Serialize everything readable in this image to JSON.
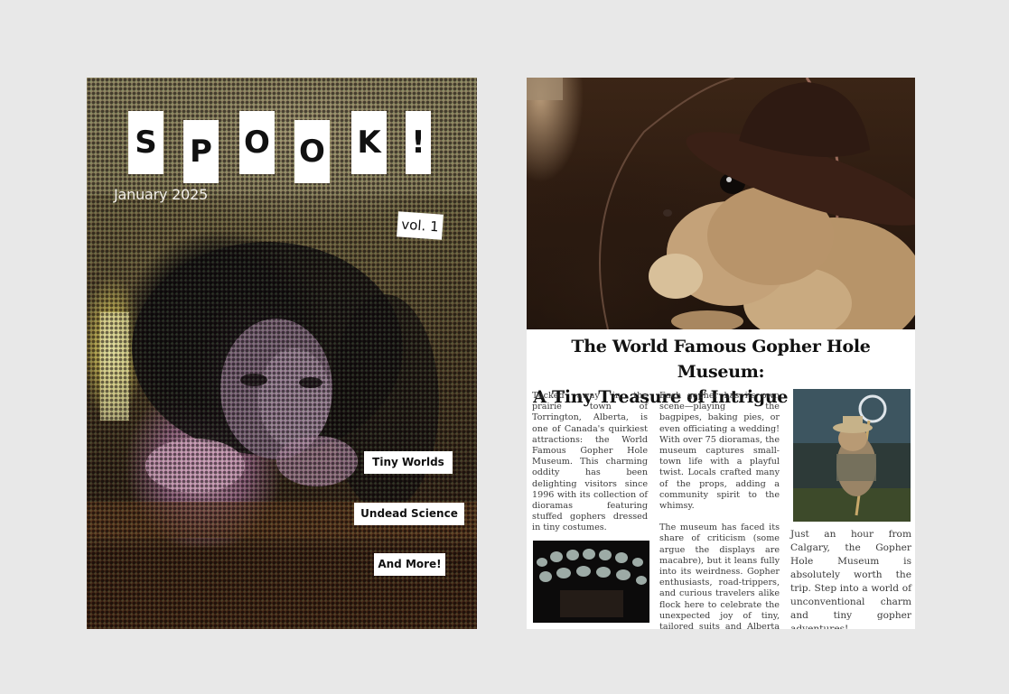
{
  "cover": {
    "title_letters": [
      "S",
      "P",
      "O",
      "O",
      "K",
      "!"
    ],
    "date": "January 2025",
    "volume": "vol. 1",
    "tags": [
      "Tiny Worlds",
      "Undead Science",
      "And More!"
    ]
  },
  "article": {
    "headline_line1": "The World Famous Gopher Hole Museum:",
    "headline_line2": "A Tiny Treasure of Intrigue and Whimsy",
    "col1_p1": "Tucked away in the prairie town of Torrington, Alberta, is one of Canada's quirkiest attractions: the World Famous Gopher Hole Museum. This charming oddity has been delighting visitors since 1996 with its collection of dioramas featuring stuffed gophers dressed in tiny costumes.",
    "col2_p1": "Each gopher has its own scene—playing the bagpipes, baking pies, or even officiating a wedding! With over 75 dioramas, the museum captures small-town life with a playful twist. Locals crafted many of the props, adding a community spirit to the whimsy.",
    "col2_p2": "The museum has faced its share of criticism (some argue the displays are macabre), but it leans fully into its weirdness. Gopher enthusiasts, road-trippers, and curious travelers alike flock here to celebrate the unexpected joy of tiny, tailored suits and Alberta pride.",
    "col3_p1": "Just an hour from Calgary, the Gopher Hole Museum is absolutely worth the trip. Step into a world of unconventional charm and tiny gopher adventures!"
  }
}
